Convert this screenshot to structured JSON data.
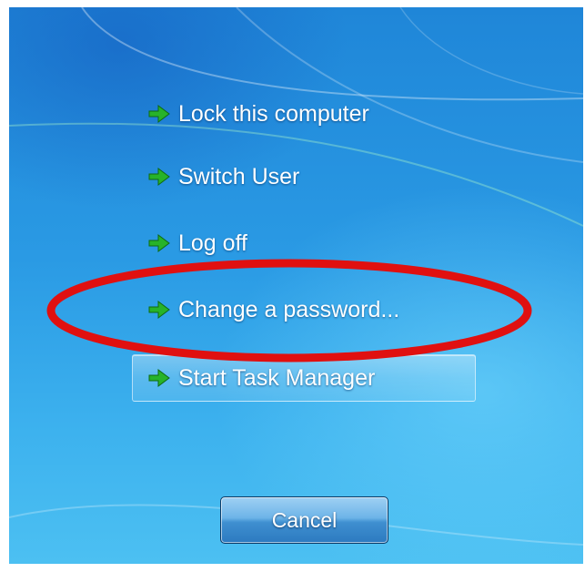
{
  "security_menu": {
    "options": [
      {
        "label": "Lock this computer"
      },
      {
        "label": "Switch User"
      },
      {
        "label": "Log off"
      },
      {
        "label": "Change a password..."
      },
      {
        "label": "Start Task Manager"
      }
    ],
    "focused_option": "Start Task Manager",
    "cancel_label": "Cancel"
  },
  "annotation": {
    "target": "Change a password...",
    "color": "#e01010"
  },
  "colors": {
    "arrow": "#27b32a",
    "background": "#2a9ae4"
  },
  "icons": {
    "option_icon": "green-right-arrow-icon"
  }
}
